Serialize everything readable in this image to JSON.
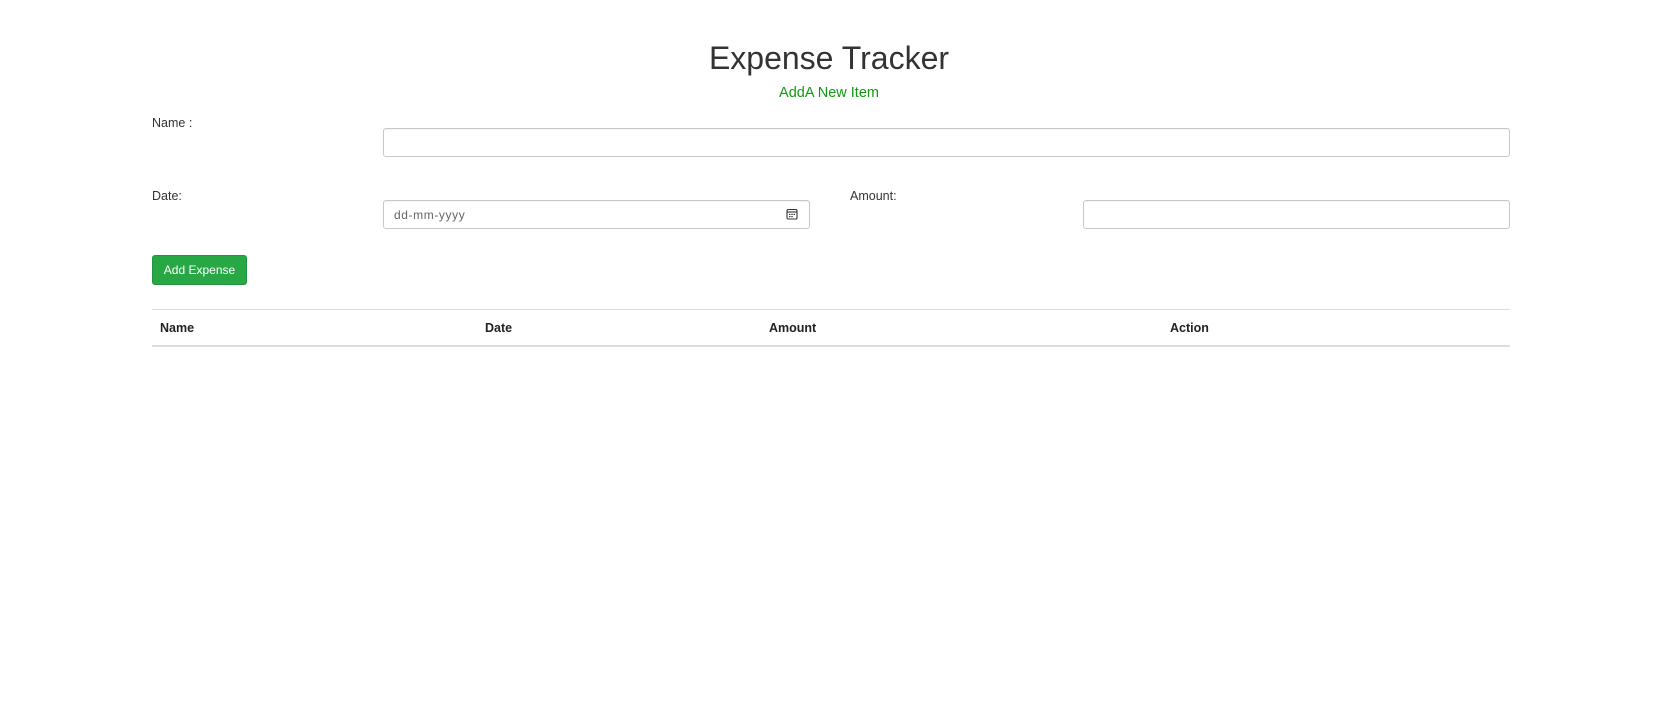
{
  "header": {
    "title": "Expense Tracker",
    "subtitle": "AddA New Item"
  },
  "form": {
    "name_label": "Name :",
    "name_value": "",
    "date_label": "Date:",
    "date_placeholder": "dd-mm-yyyy",
    "amount_label": "Amount:",
    "amount_value": "",
    "submit_label": "Add Expense"
  },
  "table": {
    "columns": [
      "Name",
      "Date",
      "Amount",
      "Action"
    ],
    "rows": []
  },
  "colors": {
    "accent": "#28a745",
    "subtitle": "#119911",
    "text": "#333333"
  }
}
